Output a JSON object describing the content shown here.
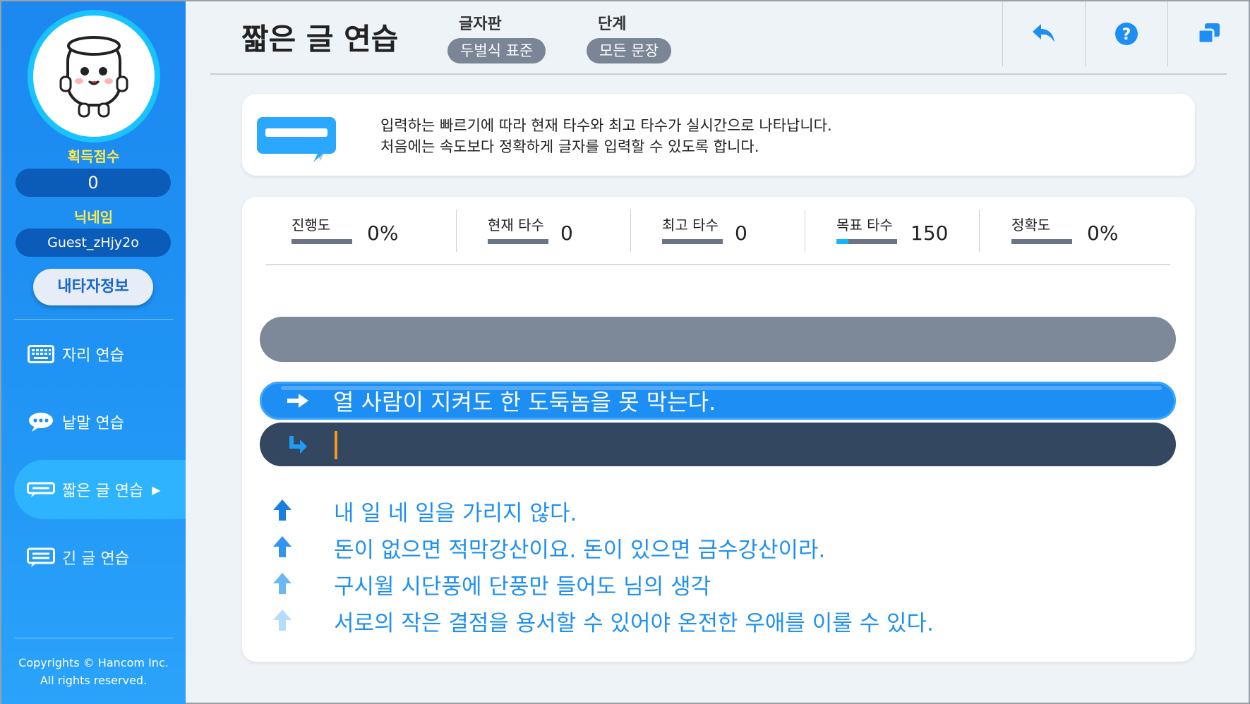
{
  "sidebar": {
    "score_label": "획득점수",
    "score_value": "0",
    "nickname_label": "닉네임",
    "nickname_value": "Guest_zHjy2o",
    "my_info_button": "내타자정보",
    "menu": [
      {
        "label": "자리 연습",
        "icon": "keyboard-icon",
        "active": false
      },
      {
        "label": "낱말 연습",
        "icon": "speech-bubble-dots-icon",
        "active": false
      },
      {
        "label": "짧은 글 연습",
        "icon": "short-text-icon",
        "active": true
      },
      {
        "label": "긴 글 연습",
        "icon": "long-text-icon",
        "active": false
      }
    ],
    "copyright_line1": "Copyrights © Hancom Inc.",
    "copyright_line2": "All rights reserved."
  },
  "header": {
    "title": "짧은 글 연습",
    "keyboard_caption": "글자판",
    "keyboard_value": "두벌식 표준",
    "stage_caption": "단계",
    "stage_value": "모든 문장",
    "buttons": [
      "back-icon",
      "help-icon",
      "window-restore-icon"
    ]
  },
  "info": {
    "line1": "입력하는 빠르기에 따라 현재 타수와 최고 타수가 실시간으로 나타납니다.",
    "line2": "처음에는 속도보다 정확하게 글자를 입력할 수 있도록 합니다."
  },
  "stats": {
    "progress_label": "진행도",
    "progress_value": "0%",
    "current_label": "현재 타수",
    "current_value": "0",
    "best_label": "최고 타수",
    "best_value": "0",
    "goal_label": "목표 타수",
    "goal_value": "150",
    "goal_fill_fraction": 0.2,
    "accuracy_label": "정확도",
    "accuracy_value": "0%"
  },
  "practice": {
    "previous_line": "",
    "target_line": "열 사람이 지켜도 한 도둑놈을 못 막는다.",
    "input_value": "",
    "next_lines": [
      "내 일 네 일을 가리지 않다.",
      "돈이 없으면 적막강산이요. 돈이 있으면 금수강산이라.",
      "구시월 시단풍에 단풍만 들어도 님의 생각",
      "서로의 작은 결점을 용서할 수 있어야 온전한 우애를 이룰 수 있다."
    ]
  },
  "colors": {
    "sidebar_blue": "#1f93f4",
    "accent_yellow": "#ffe94a",
    "target_blue": "#1c8ef4",
    "input_navy": "#334761",
    "next_text_blue": "#1e90f0"
  }
}
